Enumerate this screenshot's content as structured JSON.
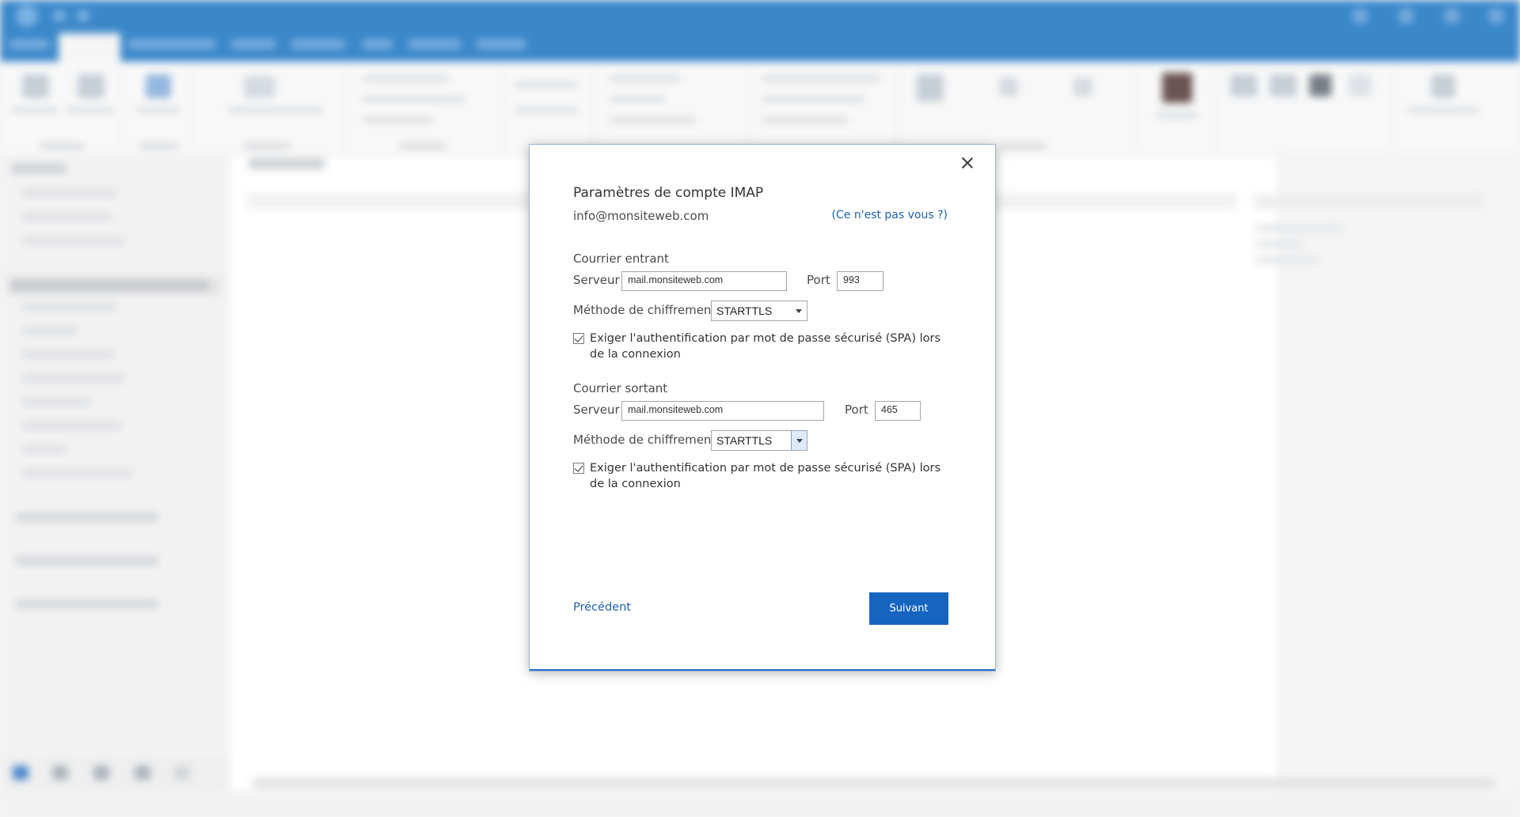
{
  "dialog": {
    "title": "Paramètres de compte IMAP",
    "email": "info@monsiteweb.com",
    "not_you_link": "(Ce n'est pas vous ?)",
    "incoming": {
      "section_label": "Courrier entrant",
      "server_label": "Serveur",
      "server_value": "mail.monsiteweb.com",
      "port_label": "Port",
      "port_value": "993",
      "encryption_label": "Méthode de chiffrement",
      "encryption_value": "STARTTLS",
      "spa_checked": true,
      "spa_label": "Exiger l'authentification par mot de passe sécurisé (SPA) lors de la connexion"
    },
    "outgoing": {
      "section_label": "Courrier sortant",
      "server_label": "Serveur",
      "server_value": "mail.monsiteweb.com",
      "port_label": "Port",
      "port_value": "465",
      "encryption_label": "Méthode de chiffrement",
      "encryption_value": "STARTTLS",
      "spa_checked": true,
      "spa_label": "Exiger l'authentification par mot de passe sécurisé (SPA) lors de la connexion"
    },
    "back_label": "Précédent",
    "next_label": "Suivant"
  },
  "colors": {
    "titlebar": "#106ebe",
    "primary_button": "#1565c0",
    "link": "#1a5fb0"
  }
}
